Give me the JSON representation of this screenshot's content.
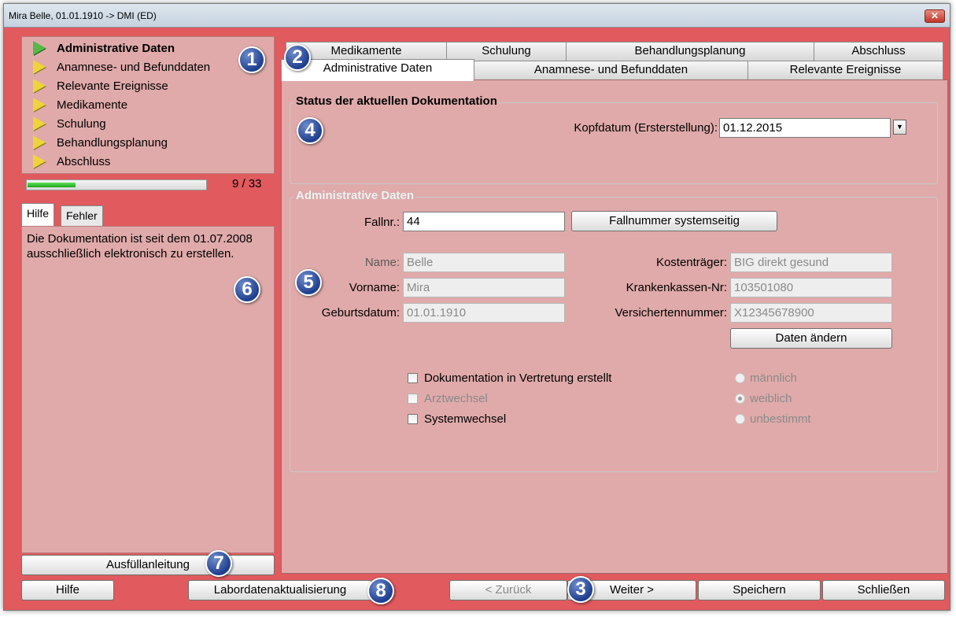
{
  "window": {
    "title": "Mira Belle, 01.01.1910 -> DMI (ED)",
    "close_icon": "close-icon"
  },
  "nav": {
    "items": [
      {
        "label": "Administrative Daten",
        "active": true
      },
      {
        "label": "Anamnese- und Befunddaten",
        "active": false
      },
      {
        "label": "Relevante Ereignisse",
        "active": false
      },
      {
        "label": "Medikamente",
        "active": false
      },
      {
        "label": "Schulung",
        "active": false
      },
      {
        "label": "Behandlungsplanung",
        "active": false
      },
      {
        "label": "Abschluss",
        "active": false
      }
    ],
    "progress_text": "9 / 33",
    "progress_fraction": 0.27
  },
  "left_tabs": {
    "hilfe": "Hilfe",
    "fehler": "Fehler"
  },
  "help_text": "Die Dokumentation ist seit dem 01.07.2008 ausschließlich elektronisch zu erstellen.",
  "buttons": {
    "ausfuellanleitung": "Ausfüllanleitung",
    "hilfe": "Hilfe",
    "labordaten": "Labordatenaktualisierung",
    "zurueck": "< Zurück",
    "weiter": "Weiter >",
    "speichern": "Speichern",
    "schliessen": "Schließen"
  },
  "tabs": {
    "back_row": [
      "Medikamente",
      "Schulung",
      "Behandlungsplanung",
      "Abschluss"
    ],
    "front_row": [
      "Administrative Daten",
      "Anamnese- und Befunddaten",
      "Relevante Ereignisse"
    ]
  },
  "status_group": {
    "legend": "Status der aktuellen Dokumentation",
    "kopfdatum_label": "Kopfdatum (Ersterstellung):",
    "kopfdatum_value": "01.12.2015"
  },
  "admin_group": {
    "legend": "Administrative Daten",
    "fallnr_label": "Fallnr.:",
    "fallnr_value": "44",
    "fallnummer_button": "Fallnummer systemseitig",
    "name_label": "Name:",
    "name_value": "Belle",
    "vorname_label": "Vorname:",
    "vorname_value": "Mira",
    "geburtsdatum_label": "Geburtsdatum:",
    "geburtsdatum_value": "01.01.1910",
    "kostentraeger_label": "Kostenträger:",
    "kostentraeger_value": "BIG direkt gesund",
    "kk_nr_label": "Krankenkassen-Nr:",
    "kk_nr_value": "103501080",
    "versicherten_label": "Versichertennummer:",
    "versicherten_value": "X12345678900",
    "daten_aendern_button": "Daten ändern",
    "checks": {
      "vertretung": "Dokumentation in Vertretung erstellt",
      "arztwechsel": "Arztwechsel",
      "systemwechsel": "Systemwechsel"
    },
    "radios": {
      "maennlich": "männlich",
      "weiblich": "weiblich",
      "unbestimmt": "unbestimmt",
      "selected": "weiblich"
    }
  },
  "badges": [
    "1",
    "2",
    "3",
    "4",
    "5",
    "6",
    "7",
    "8"
  ],
  "colors": {
    "background": "#e05a5e",
    "panel": "#e0aaaa",
    "badge": "#1f3f8f",
    "progress": "#1fa41c"
  }
}
